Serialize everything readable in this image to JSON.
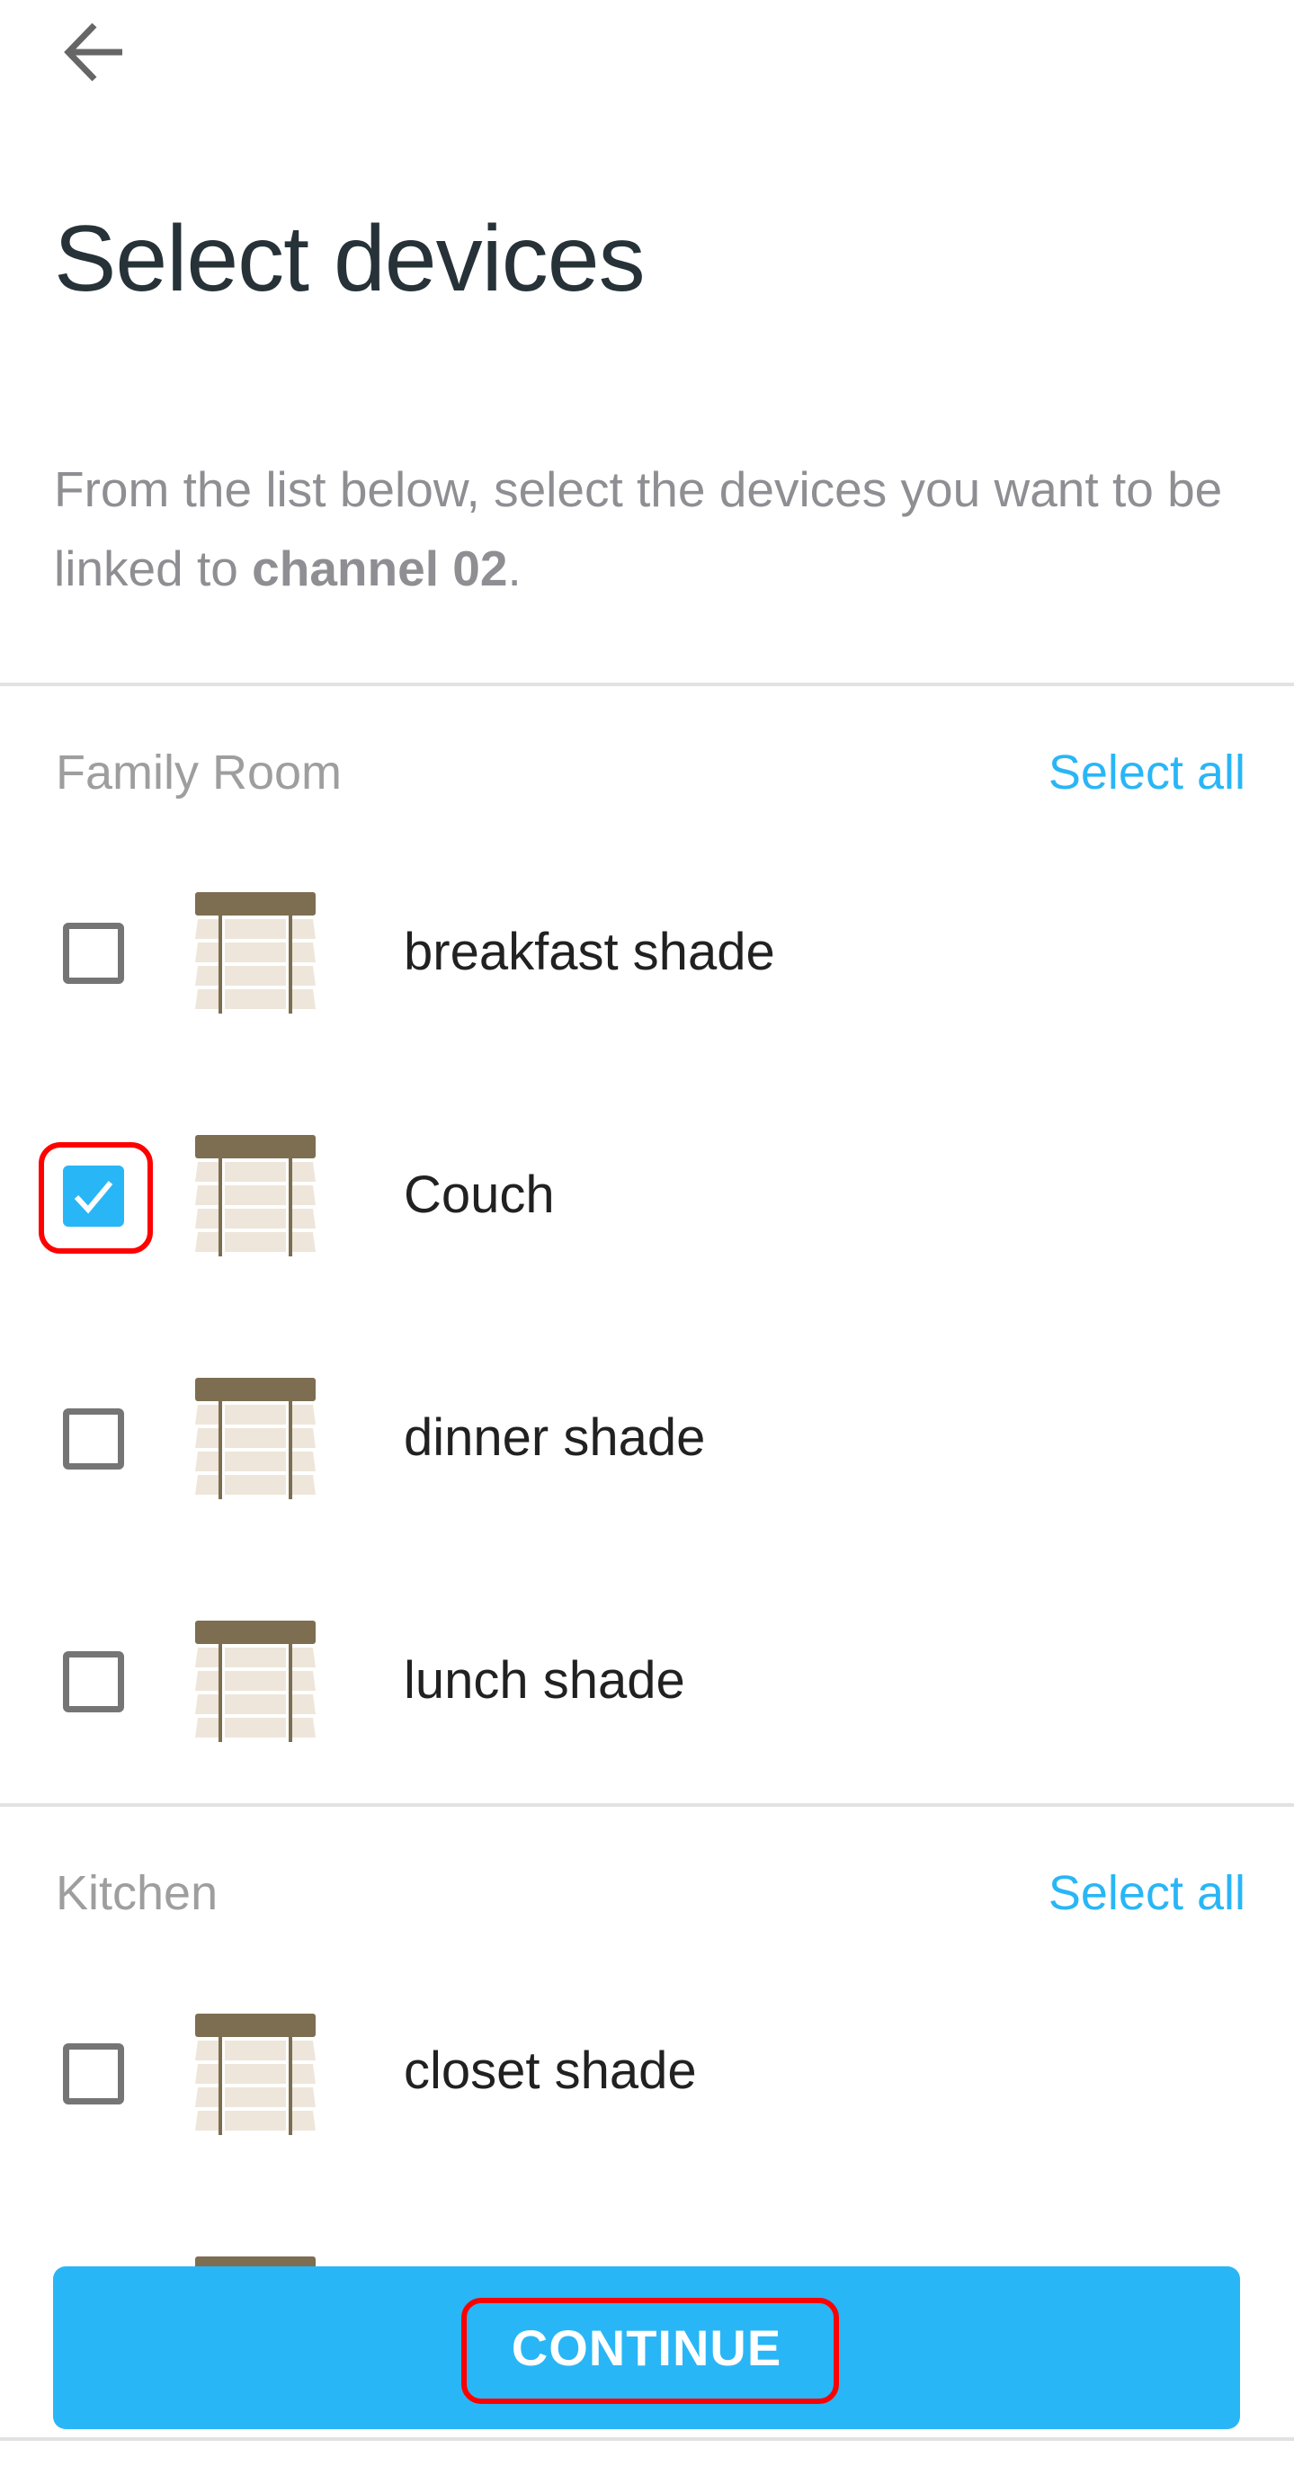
{
  "header": {
    "back_icon": "arrow-left-icon",
    "title": "Select devices"
  },
  "description": {
    "prefix": "From the list below, select the devices you want to be linked to ",
    "channel": "channel 02",
    "suffix": "."
  },
  "sections": [
    {
      "label": "Family Room",
      "select_all_label": "Select all",
      "devices": [
        {
          "name": "breakfast shade",
          "checked": false,
          "icon": "window-blind-icon"
        },
        {
          "name": "Couch",
          "checked": true,
          "icon": "window-blind-icon"
        },
        {
          "name": "dinner shade",
          "checked": false,
          "icon": "window-blind-icon"
        },
        {
          "name": "lunch shade",
          "checked": false,
          "icon": "window-blind-icon"
        }
      ]
    },
    {
      "label": "Kitchen",
      "select_all_label": "Select all",
      "devices": [
        {
          "name": "closet shade",
          "checked": false,
          "icon": "window-blind-icon"
        },
        {
          "name": "",
          "checked": false,
          "icon": "window-blind-icon"
        }
      ]
    }
  ],
  "footer": {
    "continue_label": "CONTINUE"
  },
  "colors": {
    "accent": "#29B6F6",
    "title": "#263238",
    "secondary_text": "#8E8E93",
    "section_label": "#9E9E9E",
    "checkbox_border": "#757575",
    "blind_rail": "#7D6E51",
    "blind_slat": "#EEE6DA",
    "highlight": "#FF0000"
  }
}
